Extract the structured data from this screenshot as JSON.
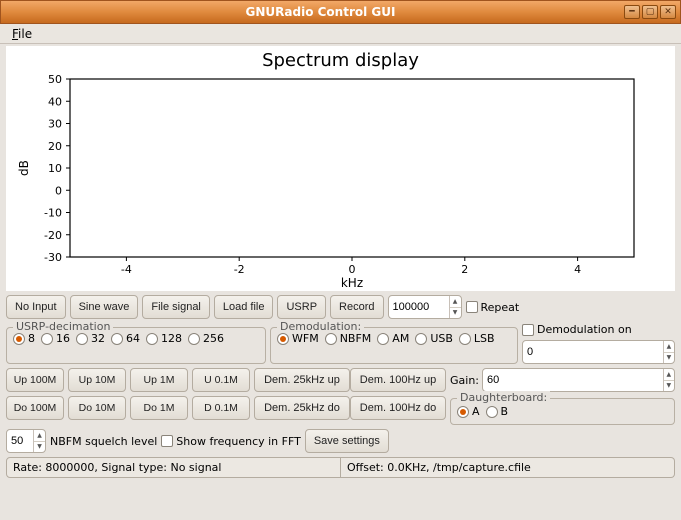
{
  "window": {
    "title": "GNURadio Control GUI"
  },
  "menu": {
    "file": "File"
  },
  "chart_data": {
    "type": "line",
    "title": "Spectrum display",
    "xlabel": "kHz",
    "ylabel": "dB",
    "x_ticks": [
      -4,
      -2,
      0,
      2,
      4
    ],
    "y_ticks": [
      -30,
      -20,
      -10,
      0,
      10,
      20,
      30,
      40,
      50
    ],
    "xlim": [
      -5,
      5
    ],
    "ylim": [
      -30,
      50
    ],
    "series": []
  },
  "toolbar": {
    "no_input": "No Input",
    "sine_wave": "Sine wave",
    "file_signal": "File signal",
    "load_file": "Load file",
    "usrp": "USRP",
    "record": "Record",
    "freq_value": "100000",
    "repeat": "Repeat"
  },
  "usrp_decimation": {
    "legend": "USRP-decimation",
    "options": [
      "8",
      "16",
      "32",
      "64",
      "128",
      "256"
    ],
    "selected": "8"
  },
  "demodulation": {
    "legend": "Demodulation:",
    "options": [
      "WFM",
      "NBFM",
      "AM",
      "USB",
      "LSB"
    ],
    "selected": "WFM",
    "on_label": "Demodulation on",
    "offset_value": "0"
  },
  "freq_steps": {
    "row_up": [
      "Up 100M",
      "Up 10M",
      "Up 1M",
      "U 0.1M"
    ],
    "row_do": [
      "Do 100M",
      "Do 10M",
      "Do 1M",
      "D 0.1M"
    ],
    "dem_up": [
      "Dem. 25kHz up",
      "Dem. 100Hz up"
    ],
    "dem_do": [
      "Dem. 25kHz do",
      "Dem. 100Hz do"
    ]
  },
  "gain": {
    "label": "Gain:",
    "value": "60"
  },
  "daughterboard": {
    "legend": "Daughterboard:",
    "options": [
      "A",
      "B"
    ],
    "selected": "A"
  },
  "squelch": {
    "value": "50",
    "label": "NBFM squelch level"
  },
  "show_freq": {
    "label": "Show frequency in FFT"
  },
  "save_settings": "Save settings",
  "status": {
    "left": "Rate: 8000000,  Signal type: No signal",
    "right": "Offset: 0.0KHz, /tmp/capture.cfile"
  }
}
